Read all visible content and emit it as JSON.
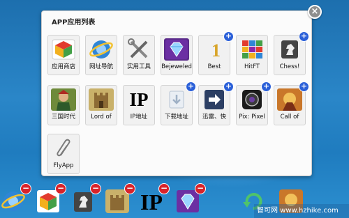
{
  "panel": {
    "title": "APP应用列表",
    "close_icon": "close-circle-icon"
  },
  "apps": [
    {
      "label": "应用商店",
      "icon": "app-store-icon",
      "add": false
    },
    {
      "label": "网址导航",
      "icon": "ie-browser-icon",
      "add": false
    },
    {
      "label": "实用工具",
      "icon": "tools-icon",
      "add": false
    },
    {
      "label": "Bejeweled",
      "icon": "gem-icon",
      "add": false
    },
    {
      "label": "Best",
      "icon": "number-one-icon",
      "add": true
    },
    {
      "label": "HitFT",
      "icon": "colorful-blocks-icon",
      "add": false
    },
    {
      "label": "Chess!",
      "icon": "chess-knight-icon",
      "add": true
    },
    {
      "label": "三国时代",
      "icon": "warrior-icon",
      "add": false
    },
    {
      "label": "Lord of",
      "icon": "castle-icon",
      "add": false
    },
    {
      "label": "IP地址",
      "icon": "ip-text-icon",
      "add": false
    },
    {
      "label": "下载地址",
      "icon": "download-icon",
      "add": true
    },
    {
      "label": "迅雷、快",
      "icon": "arrow-right-icon",
      "add": true
    },
    {
      "label": "Pix: Pixel",
      "icon": "camera-lens-icon",
      "add": true
    },
    {
      "label": "Call of",
      "icon": "game-art-icon",
      "add": true
    },
    {
      "label": "FlyApp",
      "icon": "paperclip-icon",
      "add": false
    }
  ],
  "dock": [
    {
      "icon": "ie-browser-icon",
      "remove": true
    },
    {
      "icon": "app-store-icon",
      "remove": true
    },
    {
      "icon": "chess-knight-icon",
      "remove": true
    },
    {
      "icon": "castle-icon",
      "remove": true
    },
    {
      "icon": "ip-text-icon",
      "remove": true
    },
    {
      "icon": "gem-icon",
      "remove": true
    },
    {
      "icon": "refresh-icon",
      "remove": false
    },
    {
      "icon": "game-art-icon",
      "remove": false
    }
  ],
  "icon_text": {
    "ip": "IP"
  },
  "watermark": "智可网 www.hzhike.com"
}
